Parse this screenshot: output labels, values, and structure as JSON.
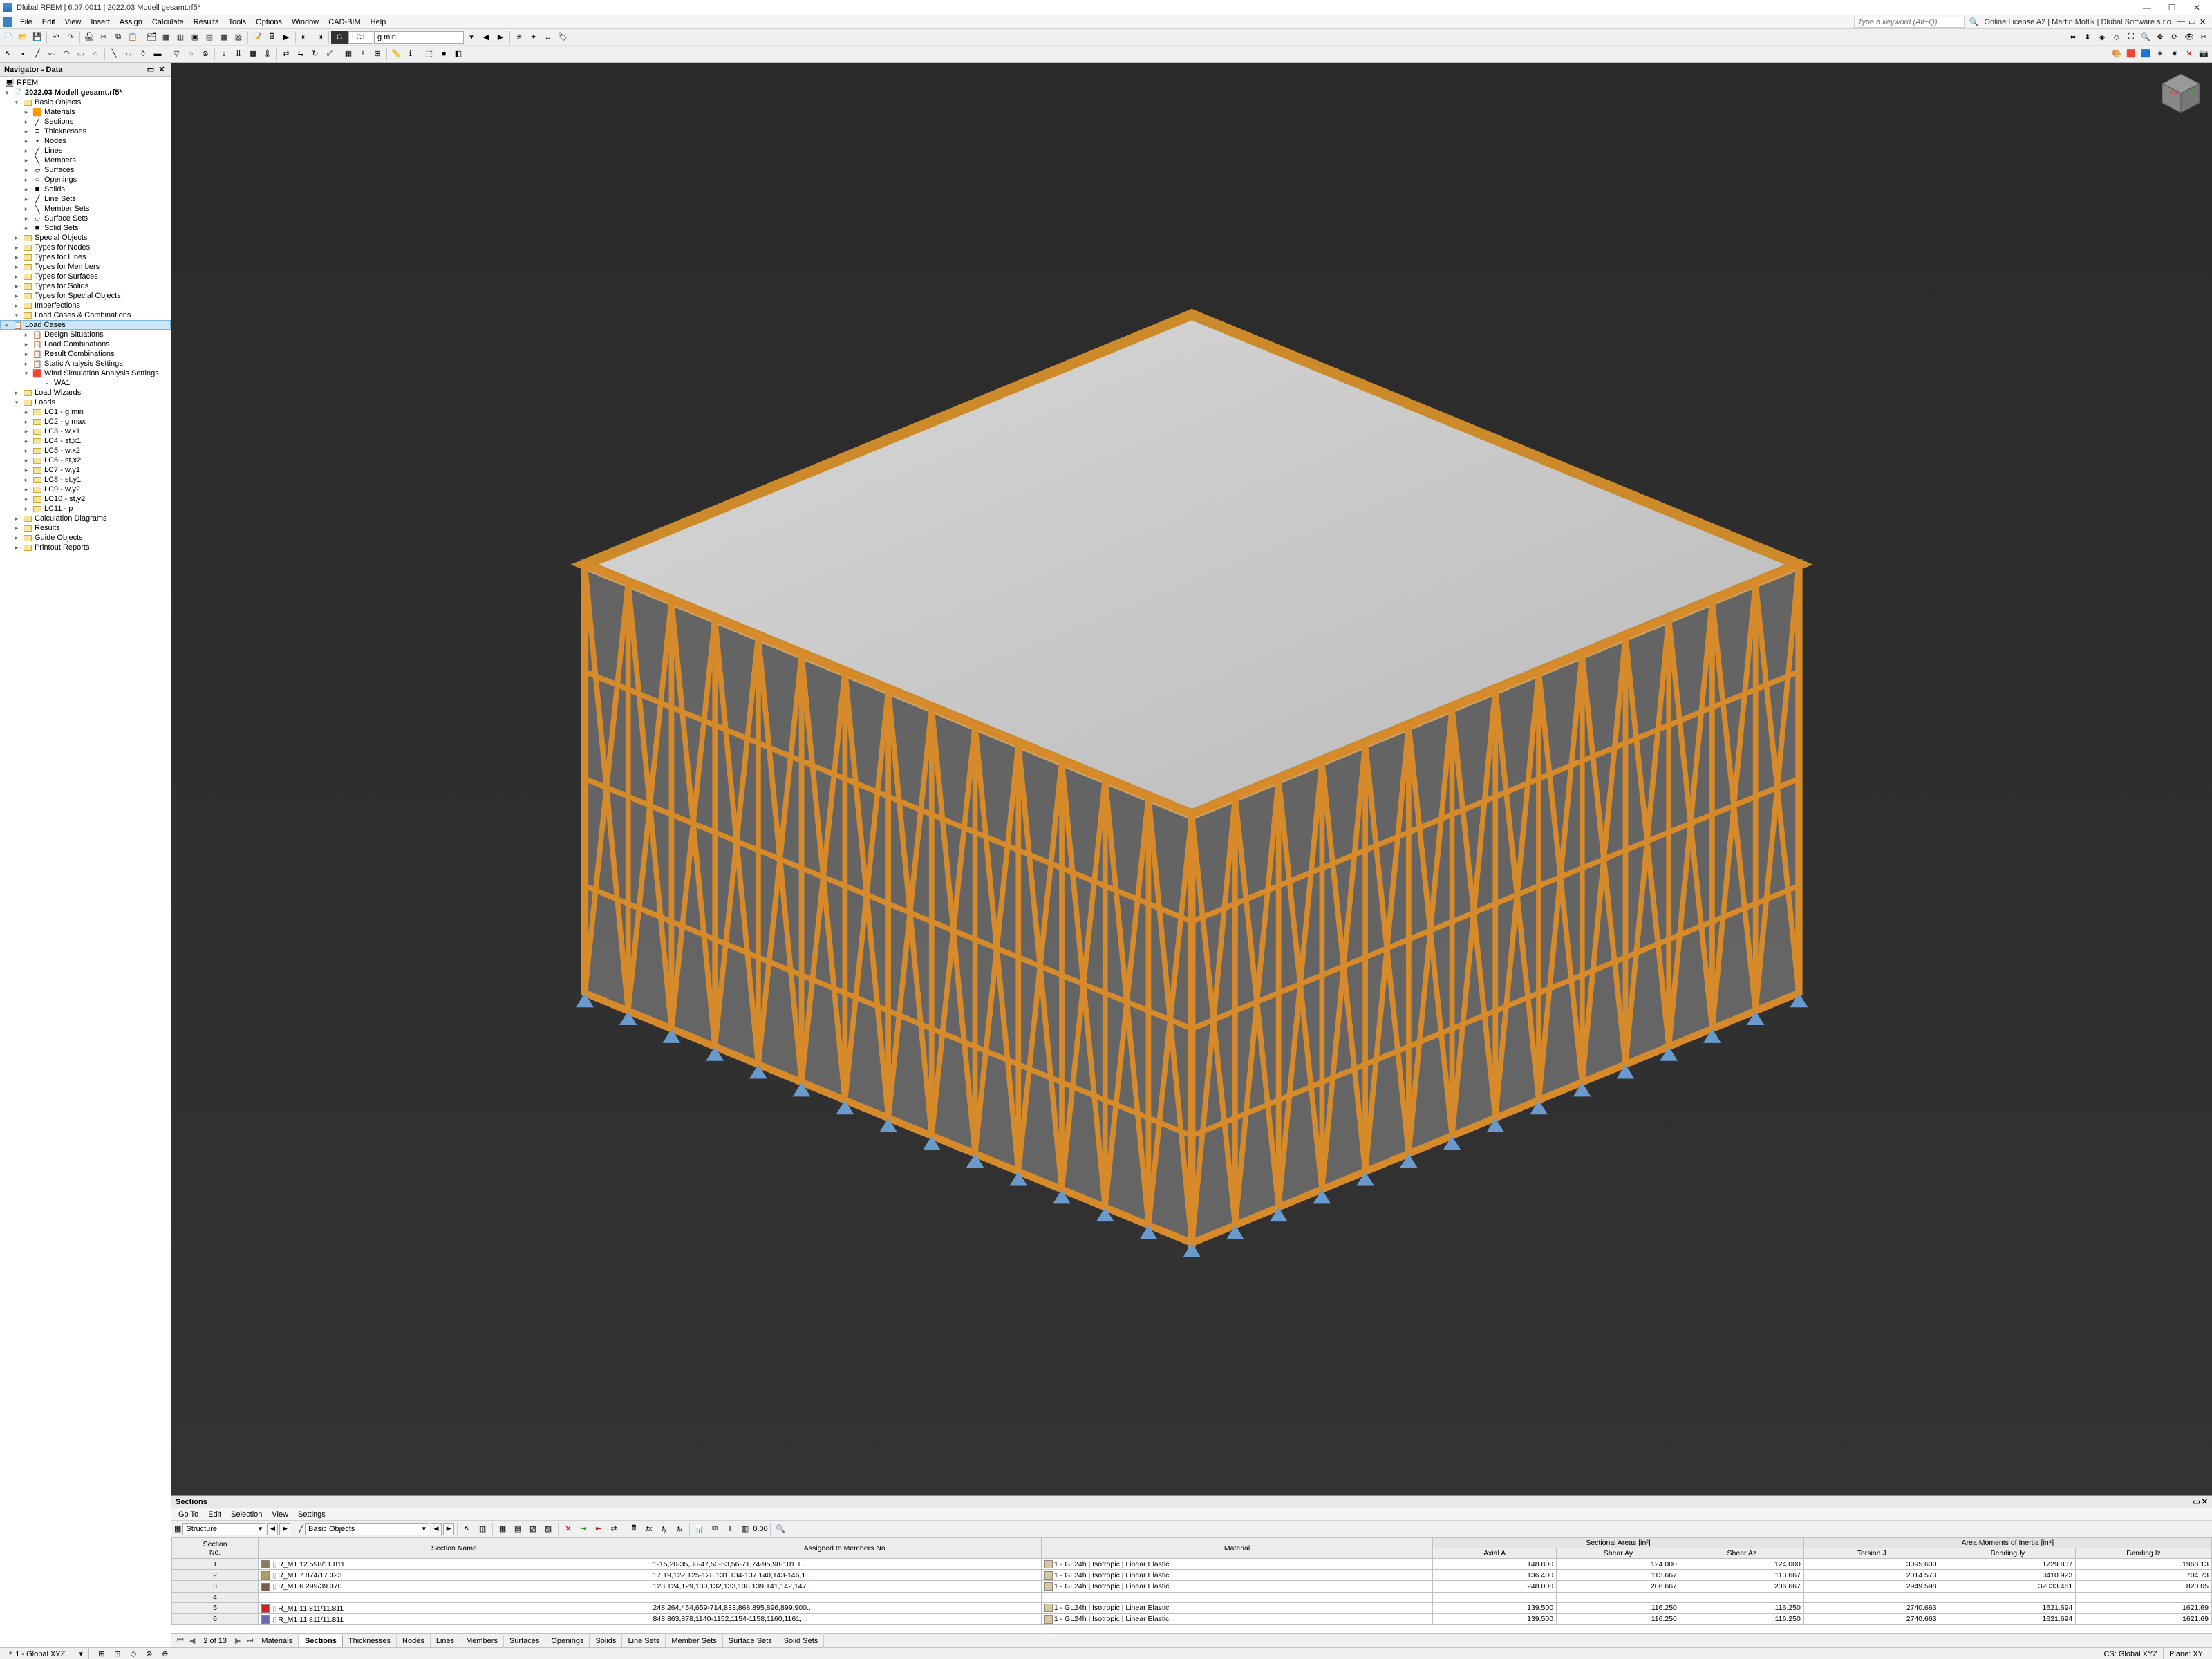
{
  "window": {
    "title": "Dlubal RFEM | 6.07.0011 | 2022.03 Modell gesamt.rf5*",
    "search_placeholder": "Type a keyword (Alt+Q)",
    "license_text": "Online License A2 | Martin Motlik | Dlubal Software s.r.o."
  },
  "menu": [
    "File",
    "Edit",
    "View",
    "Insert",
    "Assign",
    "Calculate",
    "Results",
    "Tools",
    "Options",
    "Window",
    "CAD-BIM",
    "Help"
  ],
  "toolbar2": {
    "lc_label": "LC1",
    "lc_name": "g min",
    "g_box": "G"
  },
  "navigator": {
    "title": "Navigator - Data",
    "root": "RFEM",
    "file": "2022.03 Modell gesamt.rf5*",
    "basic_objects_label": "Basic Objects",
    "basic_objects": [
      "Materials",
      "Sections",
      "Thicknesses",
      "Nodes",
      "Lines",
      "Members",
      "Surfaces",
      "Openings",
      "Solids",
      "Line Sets",
      "Member Sets",
      "Surface Sets",
      "Solid Sets"
    ],
    "mid_groups": [
      "Special Objects",
      "Types for Nodes",
      "Types for Lines",
      "Types for Members",
      "Types for Surfaces",
      "Types for Solids",
      "Types for Special Objects",
      "Imperfections"
    ],
    "lcc_label": "Load Cases & Combinations",
    "lcc_children": [
      "Load Cases",
      "Design Situations",
      "Load Combinations",
      "Result Combinations",
      "Static Analysis Settings",
      "Wind Simulation Analysis Settings"
    ],
    "wa1": "WA1",
    "load_wizards": "Load Wizards",
    "loads_label": "Loads",
    "loads": [
      "LC1 - g min",
      "LC2 - g max",
      "LC3 - w,x1",
      "LC4 - st,x1",
      "LC5 - w,x2",
      "LC6 - st,x2",
      "LC7 - w,y1",
      "LC8 - st,y1",
      "LC9 - w,y2",
      "LC10 - st,y2",
      "LC11 - p"
    ],
    "bottom_groups": [
      "Calculation Diagrams",
      "Results",
      "Guide Objects",
      "Printout Reports"
    ]
  },
  "sections": {
    "title": "Sections",
    "menu": [
      "Go To",
      "Edit",
      "Selection",
      "View",
      "Settings"
    ],
    "combo1": "Structure",
    "combo2": "Basic Objects",
    "page_indicator": "2 of 13",
    "tabs": [
      "Materials",
      "Sections",
      "Thicknesses",
      "Nodes",
      "Lines",
      "Members",
      "Surfaces",
      "Openings",
      "Solids",
      "Line Sets",
      "Member Sets",
      "Surface Sets",
      "Solid Sets"
    ],
    "active_tab": 1,
    "headers": {
      "section_no": "Section\nNo.",
      "section_name": "Section Name",
      "assigned": "Assigned to Members No.",
      "material": "Material",
      "areas_group": "Sectional Areas [in²]",
      "axial": "Axial A",
      "shear_ay": "Shear Ay",
      "shear_az": "Shear Az",
      "inertia_group": "Area Moments of Inertia [in⁴]",
      "torsion": "Torsion J",
      "bending_iy": "Bending Iy",
      "bending_iz": "Bending Iz"
    },
    "rows": [
      {
        "no": "1",
        "color": "#8a7a5a",
        "name": "R_M1 12.598/11.811",
        "assigned": "1-15,20-35,38-47,50-53,56-71,74-95,98-101,1...",
        "material": "1 - GL24h | Isotropic | Linear Elastic",
        "A": "148.800",
        "Ay": "124.000",
        "Az": "124.000",
        "J": "3095.630",
        "Iy": "1729.807",
        "Iz": "1968.13"
      },
      {
        "no": "2",
        "color": "#b49b6d",
        "name": "R_M1 7.874/17.323",
        "assigned": "17,19,122,125-128,131,134-137,140,143-146,1...",
        "material": "1 - GL24h | Isotropic | Linear Elastic",
        "A": "136.400",
        "Ay": "113.667",
        "Az": "113.667",
        "J": "2014.573",
        "Iy": "3410.923",
        "Iz": "704.73"
      },
      {
        "no": "3",
        "color": "#7a5a4a",
        "name": "R_M1 6.299/39.370",
        "assigned": "123,124,129,130,132,133,138,139,141,142,147...",
        "material": "1 - GL24h | Isotropic | Linear Elastic",
        "A": "248.000",
        "Ay": "206.667",
        "Az": "206.667",
        "J": "2949.598",
        "Iy": "32033.461",
        "Iz": "820.05"
      },
      {
        "no": "4",
        "color": "",
        "name": "",
        "assigned": "",
        "material": "",
        "A": "",
        "Ay": "",
        "Az": "",
        "J": "",
        "Iy": "",
        "Iz": ""
      },
      {
        "no": "5",
        "color": "#d02020",
        "name": "R_M1 11.811/11.811",
        "assigned": "248,264,454,659-714,833,868,895,896,899,900...",
        "material": "1 - GL24h | Isotropic | Linear Elastic",
        "A": "139.500",
        "Ay": "116.250",
        "Az": "116.250",
        "J": "2740.663",
        "Iy": "1621.694",
        "Iz": "1621.69"
      },
      {
        "no": "6",
        "color": "#6a6ab4",
        "name": "R_M1 11.811/11.811",
        "assigned": "848,863,878,1140-1152,1154-1158,1160,1161,...",
        "material": "1 - GL24h | Isotropic | Linear Elastic",
        "A": "139.500",
        "Ay": "116.250",
        "Az": "116.250",
        "J": "2740.663",
        "Iy": "1621.694",
        "Iz": "1621.69"
      }
    ]
  },
  "statusbar": {
    "coord_label": "1 - Global XYZ",
    "cs": "CS: Global XYZ",
    "plane": "Plane: XY"
  }
}
